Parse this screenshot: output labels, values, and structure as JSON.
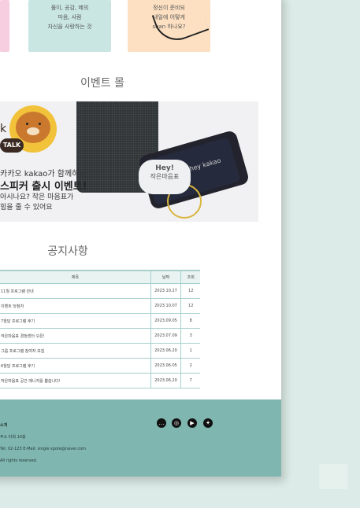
{
  "notes": {
    "mint_text": "풀이, 공감, 메의\n마음, 사람\n자신을 사랑하는 것",
    "peach_text": "정신이 준비되\n내일에 어떻게\nsean 하나요?"
  },
  "sections": {
    "event_title": "이벤트 몰",
    "notice_title": "공지사항"
  },
  "banner": {
    "talk_badge": "TALK",
    "kk_glyph": "k",
    "line1": "카카오 kakao가 함께하는",
    "line2": "스피커 출시 이벤트!",
    "line3": "아시나요? 작은 마음표가\n힘을 줄 수 있어요",
    "bubble_hey": "Hey!",
    "bubble_sub": "작은마음표",
    "phone_logo": "hey kakao"
  },
  "notice_table": {
    "headers": {
      "title": "제목",
      "date": "날짜",
      "views": "조회"
    },
    "rows": [
      {
        "title": "11월 프로그램 안내",
        "date": "2023.10.27",
        "views": "12"
      },
      {
        "title": "이벤트 당첨자",
        "date": "2023.10.07",
        "views": "12"
      },
      {
        "title": "7월달 프로그램 후기",
        "date": "2023.09.05",
        "views": "8"
      },
      {
        "title": "작은마음표 경정센터 오픈!",
        "date": "2023.07.09",
        "views": "3"
      },
      {
        "title": "그룹 프로그램 참여자 모집",
        "date": "2023.06.20",
        "views": "1"
      },
      {
        "title": "6월달 프로그램 후기",
        "date": "2023.06.05",
        "views": "2"
      },
      {
        "title": "작은마음표 공간 매니저를 뽑습니다!",
        "date": "2023.06.20",
        "views": "7"
      }
    ]
  },
  "footer": {
    "name": "소개",
    "line1": "주소 타워 10층",
    "line2": "Tel: 02-123 E-Mail: single spote@naver.com",
    "line3": "All rights reserved.",
    "social": [
      "chat-icon",
      "instagram-icon",
      "youtube-icon",
      "twitter-icon"
    ]
  }
}
